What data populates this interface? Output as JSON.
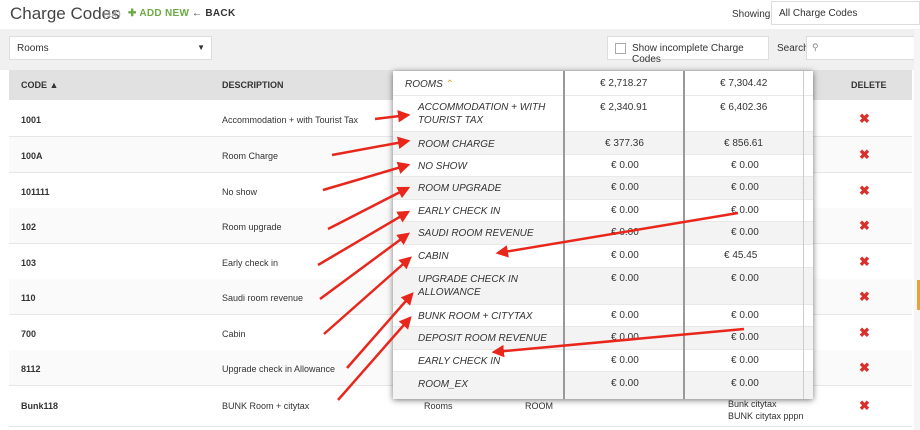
{
  "header": {
    "title": "Charge Codes",
    "count": "(14)",
    "add_new": "ADD NEW",
    "back": "BACK",
    "showing_label": "Showing",
    "showing_value": "All Charge Codes"
  },
  "toolbar": {
    "category_value": "Rooms",
    "show_incomplete": "Show incomplete Charge Codes",
    "search_label": "Search"
  },
  "table": {
    "headers": {
      "code": "CODE",
      "description": "DESCRIPTION",
      "delete": "DELETE"
    },
    "rows": [
      {
        "code": "1001",
        "description": "Accommodation + with Tourist Tax"
      },
      {
        "code": "100A",
        "description": "Room Charge"
      },
      {
        "code": "101111",
        "description": "No show"
      },
      {
        "code": "102",
        "description": "Room upgrade"
      },
      {
        "code": "103",
        "description": "Early check in"
      },
      {
        "code": "110",
        "description": "Saudi room revenue"
      },
      {
        "code": "700",
        "description": "Cabin"
      },
      {
        "code": "8112",
        "description": "Upgrade check in Allowance"
      },
      {
        "code": "Bunk118",
        "description": "BUNK Room + citytax",
        "category": "Rooms",
        "group": "ROOM",
        "tax_line1": "Bunk citytax",
        "tax_line2": "BUNK citytax pppn"
      }
    ]
  },
  "overlay": {
    "rows": [
      {
        "label": "ROOMS",
        "v1": "€ 2,718.27",
        "v2": "€ 7,304.42"
      },
      {
        "label": "ACCOMMODATION + WITH TOURIST TAX",
        "v1": "€ 2,340.91",
        "v2": "€ 6,402.36"
      },
      {
        "label": "ROOM CHARGE",
        "v1": "€ 377.36",
        "v2": "€ 856.61"
      },
      {
        "label": "NO SHOW",
        "v1": "€ 0.00",
        "v2": "€ 0.00"
      },
      {
        "label": "ROOM UPGRADE",
        "v1": "€ 0.00",
        "v2": "€ 0.00"
      },
      {
        "label": "EARLY CHECK IN",
        "v1": "€ 0.00",
        "v2": "€ 0.00"
      },
      {
        "label": "SAUDI ROOM REVENUE",
        "v1": "€ 0.00",
        "v2": "€ 0.00"
      },
      {
        "label": "CABIN",
        "v1": "€ 0.00",
        "v2": "€ 45.45"
      },
      {
        "label": "UPGRADE CHECK IN ALLOWANCE",
        "v1": "€ 0.00",
        "v2": "€ 0.00"
      },
      {
        "label": "BUNK ROOM + CITYTAX",
        "v1": "€ 0.00",
        "v2": "€ 0.00"
      },
      {
        "label": "DEPOSIT ROOM REVENUE",
        "v1": "€ 0.00",
        "v2": "€ 0.00"
      },
      {
        "label": "EARLY CHECK IN",
        "v1": "€ 0.00",
        "v2": "€ 0.00"
      },
      {
        "label": "ROOM_EX",
        "v1": "€ 0.00",
        "v2": "€ 0.00"
      }
    ]
  },
  "colors": {
    "accent_green": "#6aab46",
    "delete_red": "#d9302c",
    "arrow_red": "#e8261c",
    "expand_orange": "#e7a33a"
  },
  "icons": {
    "add": "plus-icon",
    "back": "arrow-left-icon",
    "delete": "close-icon",
    "search": "search-icon",
    "sort": "sort-asc-icon",
    "expand": "chevron-double-up-icon"
  }
}
